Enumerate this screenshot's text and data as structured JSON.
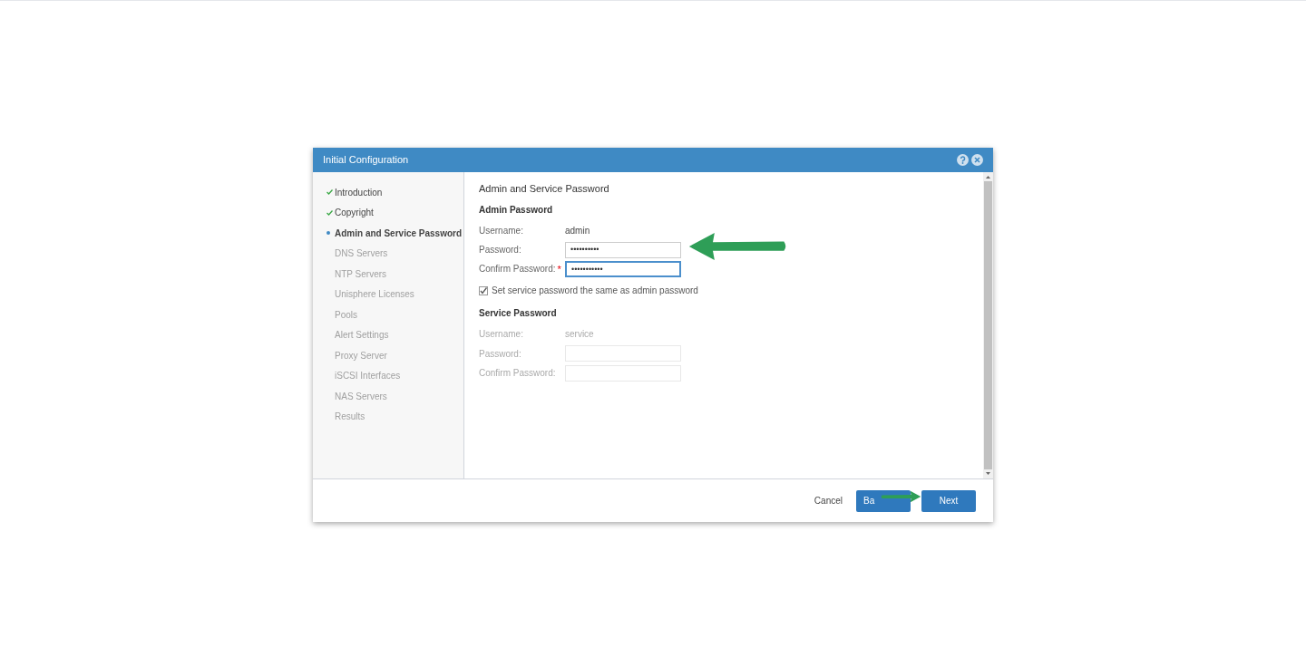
{
  "dialog": {
    "title": "Initial Configuration"
  },
  "steps": [
    {
      "label": "Introduction",
      "checked": true,
      "selected": false
    },
    {
      "label": "Copyright",
      "checked": true,
      "selected": false
    },
    {
      "label": "Admin and Service Password",
      "checked": false,
      "selected": true
    },
    {
      "label": "DNS Servers",
      "checked": false,
      "selected": false
    },
    {
      "label": "NTP Servers",
      "checked": false,
      "selected": false
    },
    {
      "label": "Unisphere Licenses",
      "checked": false,
      "selected": false
    },
    {
      "label": "Pools",
      "checked": false,
      "selected": false
    },
    {
      "label": "Alert Settings",
      "checked": false,
      "selected": false
    },
    {
      "label": "Proxy Server",
      "checked": false,
      "selected": false
    },
    {
      "label": "iSCSI Interfaces",
      "checked": false,
      "selected": false
    },
    {
      "label": "NAS Servers",
      "checked": false,
      "selected": false
    },
    {
      "label": "Results",
      "checked": false,
      "selected": false
    }
  ],
  "page_title": "Admin and Service Password",
  "sections": [
    {
      "title": "Admin Password",
      "disabled": false,
      "fields": [
        {
          "label": "Username:",
          "kind": "text",
          "value": "admin"
        },
        {
          "label": "Password:",
          "kind": "input",
          "value": "••••••••••",
          "focused": false
        },
        {
          "label": "Confirm Password:",
          "kind": "input",
          "value": "•••••••••••",
          "required_mark": "*",
          "focused": true
        }
      ],
      "checkbox": {
        "label": "Set service password the same as admin password",
        "checked": true
      }
    },
    {
      "title": "Service Password",
      "disabled": true,
      "fields": [
        {
          "label": "Username:",
          "kind": "text",
          "value": "service"
        },
        {
          "label": "Password:",
          "kind": "input",
          "focused": false
        },
        {
          "label": "Confirm Password:",
          "kind": "input",
          "focused": false
        }
      ]
    }
  ],
  "buttons": [
    {
      "label": "Cancel",
      "kind": "plain"
    },
    {
      "label": "Ba",
      "kind": "primary"
    },
    {
      "label": "Next",
      "kind": "primary"
    }
  ]
}
